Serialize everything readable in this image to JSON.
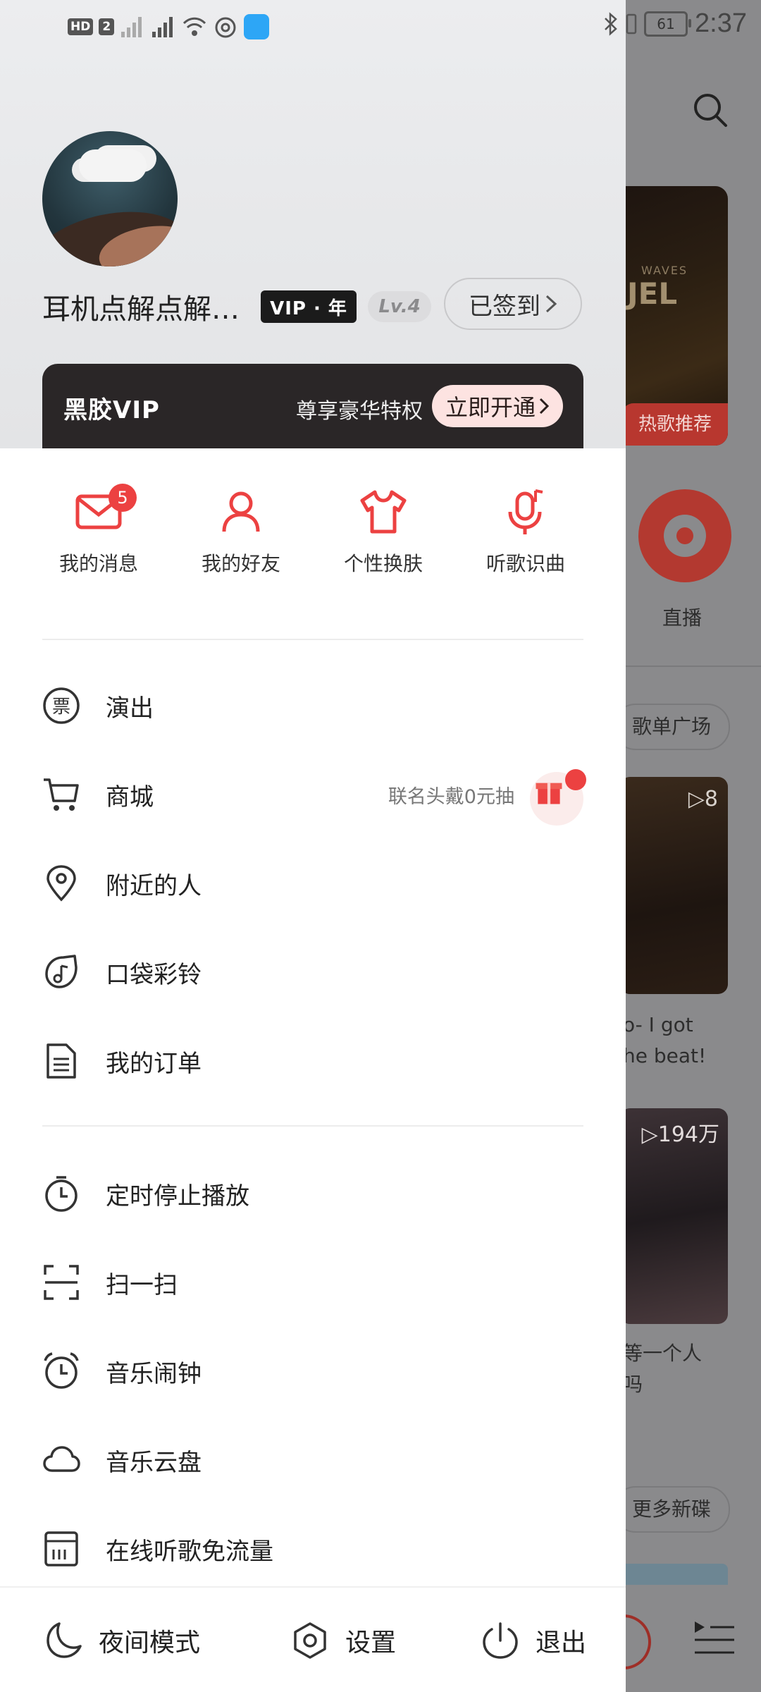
{
  "status_bar": {
    "hd": "HD",
    "sim": "2",
    "battery": "61",
    "time": "2:37"
  },
  "background_app": {
    "banner_tag": "热歌推荐",
    "banner_small": "WAVES",
    "banner_big": "JEL",
    "live_label": "直播",
    "playlist_plaza": "歌单广场",
    "card1_count": "▷8",
    "card1_caption": [
      "o- I got",
      "he beat!"
    ],
    "card2_count": "▷194万",
    "card2_caption": [
      "等一个人",
      "吗"
    ],
    "more_albums": "更多新碟"
  },
  "profile": {
    "username": "耳机点解点解点解",
    "vip_badge": "VIP · 年",
    "level": "Lv.4",
    "signin_label": "已签到",
    "vip_bar": {
      "logo": "黑胶VIP",
      "slogan": "尊享豪华特权",
      "open_label": "立即开通"
    }
  },
  "quick_actions": [
    {
      "label": "我的消息",
      "icon": "mail-icon",
      "badge": "5"
    },
    {
      "label": "我的好友",
      "icon": "friend-icon"
    },
    {
      "label": "个性换肤",
      "icon": "shirt-icon"
    },
    {
      "label": "听歌识曲",
      "icon": "mic-note-icon"
    }
  ],
  "menu_group1": [
    {
      "label": "演出",
      "icon": "ticket-icon"
    },
    {
      "label": "商城",
      "icon": "cart-icon",
      "hint": "联名头戴0元抽"
    },
    {
      "label": "附近的人",
      "icon": "location-icon"
    },
    {
      "label": "口袋彩铃",
      "icon": "ringtone-icon"
    },
    {
      "label": "我的订单",
      "icon": "order-icon"
    }
  ],
  "menu_group2": [
    {
      "label": "定时停止播放",
      "icon": "timer-icon"
    },
    {
      "label": "扫一扫",
      "icon": "scan-icon"
    },
    {
      "label": "音乐闹钟",
      "icon": "alarm-icon"
    },
    {
      "label": "音乐云盘",
      "icon": "cloud-icon"
    },
    {
      "label": "在线听歌免流量",
      "icon": "sim-card-icon"
    }
  ],
  "bottom_bar": {
    "night_mode": "夜间模式",
    "settings": "设置",
    "logout": "退出"
  },
  "colors": {
    "accent": "#ec4141",
    "drawer_bg": "#ffffff",
    "vip_bar_bg": "#2a2627"
  }
}
